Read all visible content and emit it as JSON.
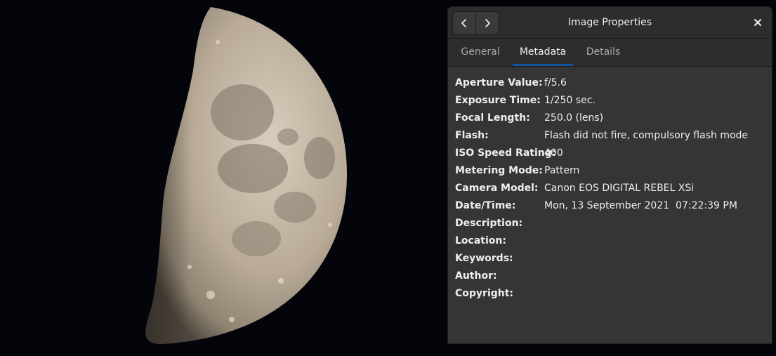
{
  "window": {
    "title": "Image Properties",
    "back_icon": "chevron-left-icon",
    "forward_icon": "chevron-right-icon",
    "close_icon": "close-icon"
  },
  "tabs": [
    {
      "label": "General",
      "active": false
    },
    {
      "label": "Metadata",
      "active": true
    },
    {
      "label": "Details",
      "active": false
    }
  ],
  "colors": {
    "accent": "#15539e",
    "dialog_bg": "#353535",
    "header_bg": "#2d2d2d",
    "text": "#eeeeec"
  },
  "metadata": [
    {
      "key": "Aperture Value:",
      "value": "f/5.6"
    },
    {
      "key": "Exposure Time:",
      "value": "1/250 sec."
    },
    {
      "key": "Focal Length:",
      "value": "250.0 (lens)"
    },
    {
      "key": "Flash:",
      "value": "Flash did not fire, compulsory flash mode"
    },
    {
      "key": "ISO Speed Rating:",
      "value": "400"
    },
    {
      "key": "Metering Mode:",
      "value": "Pattern"
    },
    {
      "key": "Camera Model:",
      "value": "Canon EOS DIGITAL REBEL XSi"
    },
    {
      "key": "Date/Time:",
      "value": "Mon, 13 September 2021  07:22:39 PM"
    },
    {
      "key": "Description:",
      "value": ""
    },
    {
      "key": "Location:",
      "value": ""
    },
    {
      "key": "Keywords:",
      "value": ""
    },
    {
      "key": "Author:",
      "value": ""
    },
    {
      "key": "Copyright:",
      "value": ""
    }
  ]
}
